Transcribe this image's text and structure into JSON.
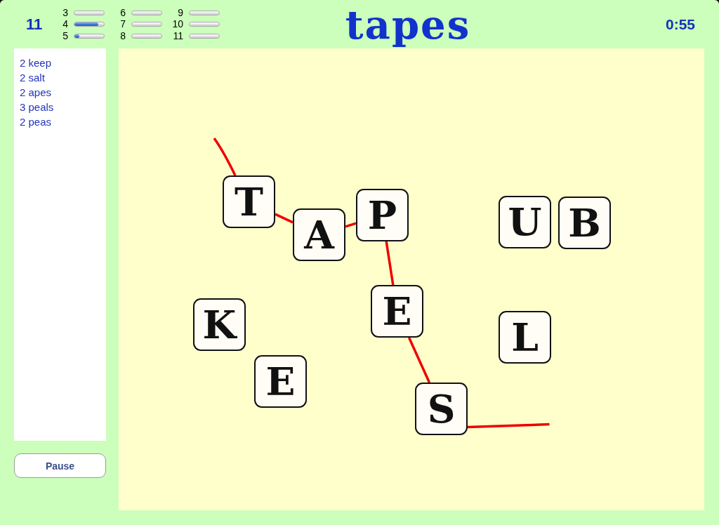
{
  "count": "11",
  "meters": [
    {
      "label": "3",
      "level": 0
    },
    {
      "label": "4",
      "level": 0.8
    },
    {
      "label": "5",
      "level": 0.17
    },
    {
      "label": "6",
      "level": 0
    },
    {
      "label": "7",
      "level": 0
    },
    {
      "label": "8",
      "level": 0
    },
    {
      "label": "9",
      "level": 0
    },
    {
      "label": "10",
      "level": 0
    },
    {
      "label": "11",
      "level": 0
    }
  ],
  "title": "tapes",
  "timer": "0:55",
  "word_list": [
    "2 keep",
    "2 salt",
    "2 apes",
    "3 peals",
    "2 peas"
  ],
  "pause_button": {
    "label": "Pause"
  },
  "tiles": [
    {
      "letter": "T",
      "selected": true
    },
    {
      "letter": "A",
      "selected": true
    },
    {
      "letter": "P",
      "selected": true
    },
    {
      "letter": "U",
      "selected": false
    },
    {
      "letter": "B",
      "selected": false
    },
    {
      "letter": "K",
      "selected": false
    },
    {
      "letter": "E",
      "selected": true
    },
    {
      "letter": "L",
      "selected": false
    },
    {
      "letter": "E",
      "selected": false
    },
    {
      "letter": "S",
      "selected": true
    }
  ]
}
